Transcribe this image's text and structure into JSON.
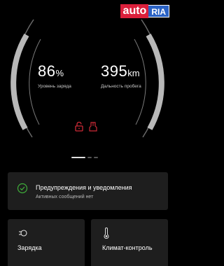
{
  "watermark": {
    "part1": "auto",
    "part2": "RIA"
  },
  "battery": {
    "value": "86",
    "unit": "%",
    "label": "Уровень заряда"
  },
  "range": {
    "value": "395",
    "unit": "km",
    "label": "Дальность пробега"
  },
  "pager": {
    "count": 3,
    "active": 0
  },
  "alerts": {
    "title": "Предупреждения и уведомления",
    "subtitle": "Активных сообщений нет"
  },
  "tiles": [
    {
      "label": "Зарядка",
      "icon": "charging-plug-icon"
    },
    {
      "label": "Климат-контроль",
      "icon": "thermometer-icon"
    }
  ],
  "colors": {
    "accent_red": "#cc2a36",
    "check_green": "#3fae3a",
    "card_bg": "#1e1e1e"
  }
}
